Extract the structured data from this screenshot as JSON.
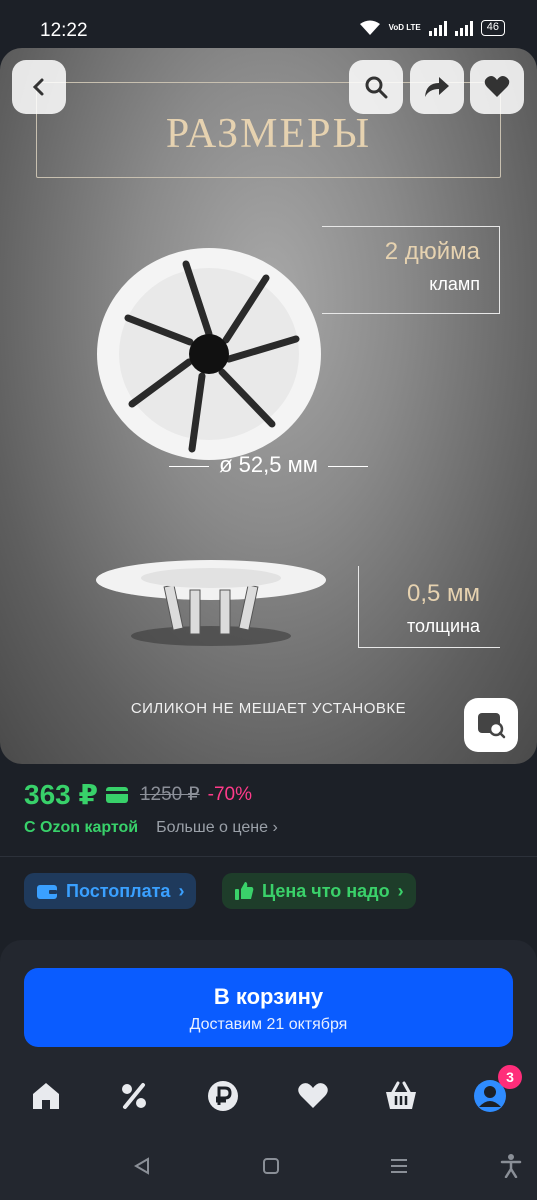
{
  "status": {
    "time": "12:22",
    "network": "VoD LTE",
    "battery": "46"
  },
  "hero": {
    "title": "РАЗМЕРЫ",
    "clamp_value": "2 дюйма",
    "clamp_label": "кламп",
    "diameter": "ø 52,5 мм",
    "thickness_value": "0,5 мм",
    "thickness_label": "толщина",
    "tagline": "СИЛИКОН НЕ МЕШАЕТ УСТАНОВКЕ"
  },
  "header_icons": [
    "back-icon",
    "search-icon",
    "share-icon",
    "heart-icon"
  ],
  "price": {
    "current": "363 ₽",
    "old": "1250 ₽",
    "discount": "-70%",
    "ozon_card": "С Ozon картой",
    "more_link": "Больше о цене"
  },
  "chips": {
    "postpay": "Постоплата",
    "fair_price": "Цена что надо"
  },
  "cart": {
    "label": "В корзину",
    "delivery": "Доставим 21 октября"
  },
  "bottom_nav": {
    "items": [
      "home-icon",
      "percent-icon",
      "ruble-icon",
      "heart-icon",
      "basket-icon",
      "profile-icon"
    ],
    "profile_badge": "3"
  },
  "colors": {
    "accent_green": "#38d16a",
    "accent_blue": "#0a5cff",
    "discount_pink": "#ff3b8a"
  }
}
